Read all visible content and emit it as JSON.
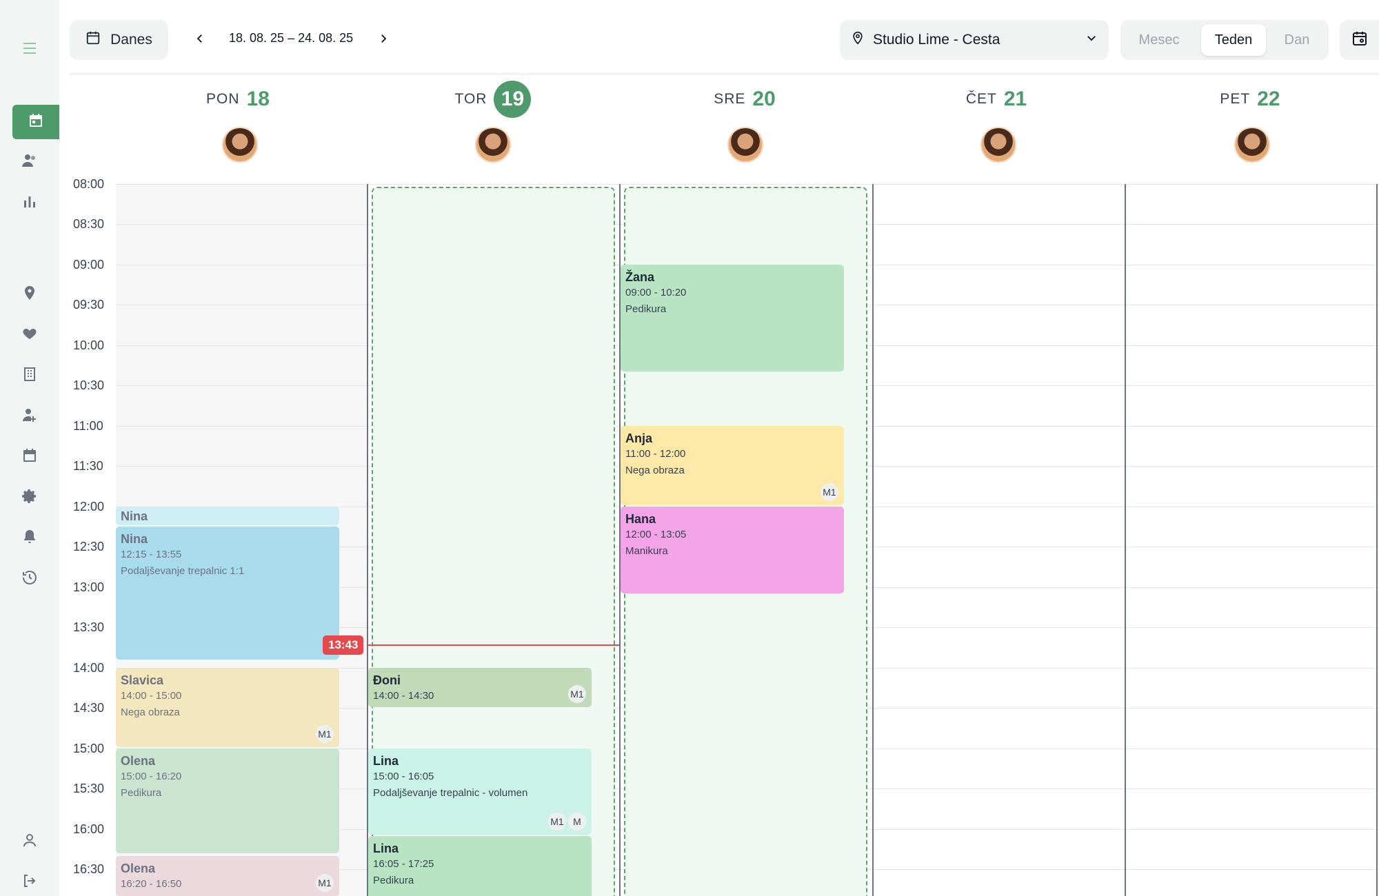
{
  "sidebar": {
    "items": [
      {
        "icon": "menu-icon"
      },
      {
        "icon": "calendar-icon",
        "active": true
      },
      {
        "icon": "users-icon"
      },
      {
        "icon": "bar-chart-icon"
      },
      {
        "icon": "location-icon"
      },
      {
        "icon": "heart-hand-icon"
      },
      {
        "icon": "building-icon"
      },
      {
        "icon": "user-add-icon"
      },
      {
        "icon": "calendar-event-icon"
      },
      {
        "icon": "settings-icon"
      },
      {
        "icon": "bell-icon"
      },
      {
        "icon": "history-icon"
      },
      {
        "icon": "profile-icon"
      },
      {
        "icon": "logout-icon"
      }
    ]
  },
  "toolbar": {
    "today_label": "Danes",
    "date_range": "18. 08. 25 – 24. 08. 25",
    "location": "Studio Lime - Cesta",
    "views": [
      "Mesec",
      "Teden",
      "Dan"
    ],
    "active_view": "Teden"
  },
  "days": [
    {
      "name": "PON",
      "num": "18"
    },
    {
      "name": "TOR",
      "num": "19",
      "today": true
    },
    {
      "name": "SRE",
      "num": "20"
    },
    {
      "name": "ČET",
      "num": "21"
    },
    {
      "name": "PET",
      "num": "22"
    }
  ],
  "times": [
    "08:00",
    "08:30",
    "09:00",
    "09:30",
    "10:00",
    "10:30",
    "11:00",
    "11:30",
    "12:00",
    "12:30",
    "13:00",
    "13:30",
    "14:00",
    "14:30",
    "15:00",
    "15:30",
    "16:00",
    "16:30"
  ],
  "current_time": "13:43",
  "events": {
    "mon_nina_label": {
      "name": "Nina"
    },
    "mon_nina": {
      "name": "Nina",
      "time": "12:15 - 13:55",
      "service": "Podaljševanje trepalnic 1:1"
    },
    "mon_slavica": {
      "name": "Slavica",
      "time": "14:00 - 15:00",
      "service": "Nega obraza",
      "badges": [
        "M1"
      ]
    },
    "mon_olena1": {
      "name": "Olena",
      "time": "15:00 - 16:20",
      "service": "Pedikura"
    },
    "mon_olena2": {
      "name": "Olena",
      "time": "16:20 - 16:50",
      "badges": [
        "M1"
      ]
    },
    "tue_doni": {
      "name": "Đoni",
      "time": "14:00 - 14:30",
      "badges": [
        "M1"
      ]
    },
    "tue_lina1": {
      "name": "Lina",
      "time": "15:00 - 16:05",
      "service": "Podaljševanje trepalnic - volumen",
      "badges": [
        "M1",
        "M"
      ]
    },
    "tue_lina2": {
      "name": "Lina",
      "time": "16:05 - 17:25",
      "service": "Pedikura"
    },
    "wed_zana": {
      "name": "Žana",
      "time": "09:00 - 10:20",
      "service": "Pedikura"
    },
    "wed_anja": {
      "name": "Anja",
      "time": "11:00 - 12:00",
      "service": "Nega obraza",
      "badges": [
        "M1"
      ]
    },
    "wed_hana": {
      "name": "Hana",
      "time": "12:00 - 13:05",
      "service": "Manikura"
    }
  },
  "colors": {
    "accent": "#4e9a6b",
    "now": "#e5484d",
    "blue": "#a8dced",
    "light_blue": "#cdeef6",
    "sand": "#f4e6bd",
    "sage": "#c9e4cf",
    "pink_pale": "#ecd9dd",
    "olive": "#c1dbb8",
    "mint": "#cbf2e6",
    "green": "#b9e4c4",
    "yellow": "#fde9a7",
    "magenta": "#f2a4e7"
  }
}
